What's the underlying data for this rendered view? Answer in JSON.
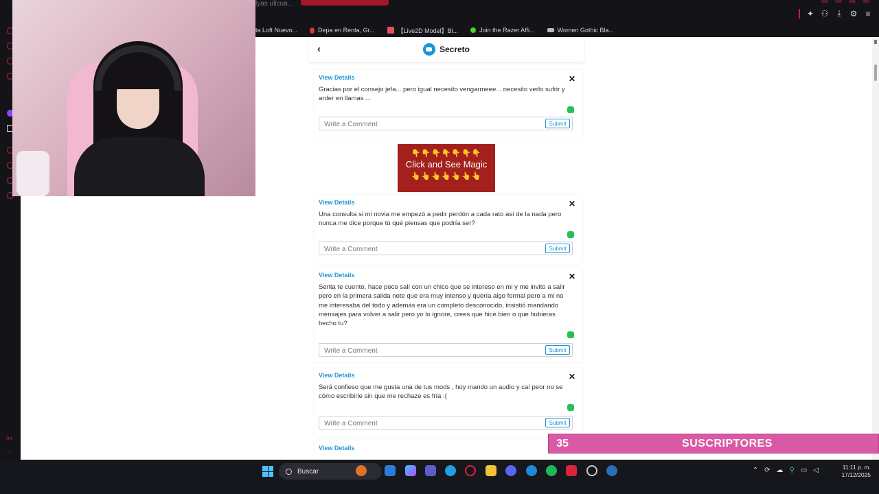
{
  "browser": {
    "partial_tab": "lyas ulicua...",
    "bookmarks": [
      {
        "label": "ta Loft Nuevo...",
        "color": "#777777"
      },
      {
        "label": "Depa en Renta, Gr...",
        "color": "#d33a2c"
      },
      {
        "label": "【Live2D Model】Bl...",
        "color": "#e0525c"
      },
      {
        "label": "Join the Razer Affi...",
        "color": "#44d62c"
      },
      {
        "label": "Women Gothic Bla...",
        "color": "#bbbbbb"
      }
    ]
  },
  "app": {
    "title": "Secreto",
    "back_icon": "chevron-left-icon"
  },
  "posts": [
    {
      "view_details": "View Details",
      "text": "Gracias por el consejo jefa... pero igual necesito vengarmeee... necesito verlo sufrir y arder en llamas ...",
      "comment_placeholder": "Write a Comment",
      "submit_label": "Submit"
    },
    {
      "view_details": "View Details",
      "text": "Una consulta si mi novia me empezó a pedir perdón a cada rato así de la nada pero nunca me dice porque tú qué piensas que podría ser?",
      "comment_placeholder": "Write a Comment",
      "submit_label": "Submit"
    },
    {
      "view_details": "View Details",
      "text": "Serita te cuento, hace poco salí con un chico que se intereso en mi y me invito a salir pero en la primera salida note que era muy intenso y quería algo formal pero a mi no me interesaba del todo y además era un completo desconocido, insistió mandando mensajes para volver a salir pero yo lo ignore, crees que hice bien o que hubieras hecho tu?",
      "comment_placeholder": "Write a Comment",
      "submit_label": "Submit"
    },
    {
      "view_details": "View Details",
      "text": "Será confieso que me gusta una de tus mods , hoy mando un audio y caí peor no se cómo escribirle sin que me rechaze es fría :(",
      "comment_placeholder": "Write a Comment",
      "submit_label": "Submit"
    },
    {
      "view_details": "View Details"
    }
  ],
  "ad": {
    "fingers_top": "👇👇👇👇👇👇👇",
    "text": "Click and See Magic",
    "fingers_bottom": "👆👆👆👆👆👆👆"
  },
  "overlay": {
    "count": "35",
    "label": "SUSCRIPTORES"
  },
  "taskbar": {
    "search_label": "Buscar",
    "time": "11:11 p. m.",
    "date": "17/12/2025",
    "accent": "#4cc2ff"
  }
}
